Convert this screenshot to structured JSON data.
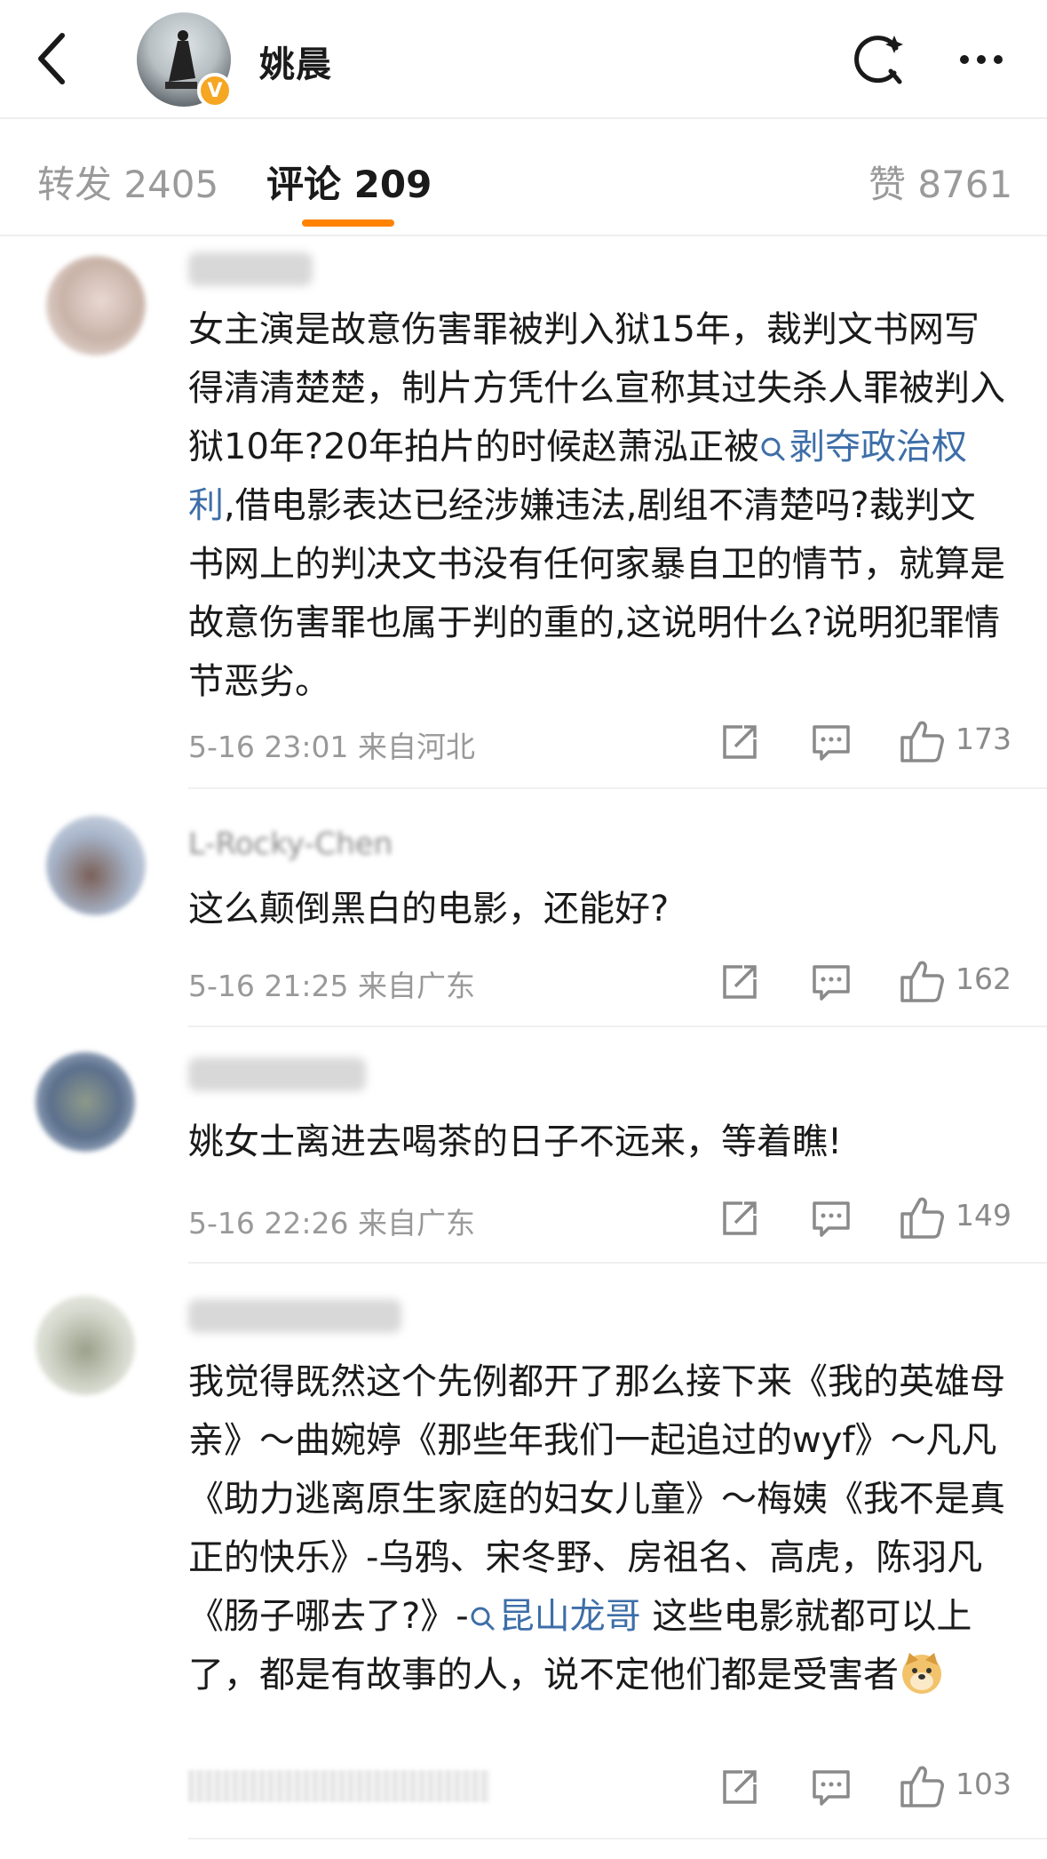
{
  "header": {
    "back_icon": "chevron-left-icon",
    "user_name": "姚晨",
    "vip_badge": "V",
    "refresh_icon": "refresh-icon",
    "more_icon": "more-dots-icon"
  },
  "tabs": {
    "repost": "转发 2405",
    "comments": "评论 209",
    "likes": "赞 8761",
    "accent": "#ff8200"
  },
  "comments": [
    {
      "username": "",
      "text_before": "女主演是故意伤害罪被判入狱15年，裁判文书网写得清清楚楚，制片方凭什么宣称其过失杀人罪被判入狱10年?20年拍片的时候赵萧泓正被",
      "topic": "剥夺政治权利",
      "text_after": ",借电影表达已经涉嫌违法,剧组不清楚吗?裁判文书网上的判决文书没有任何家暴自卫的情节，就算是故意伤害罪也属于判的重的,这说明什么?说明犯罪情节恶劣。",
      "meta": "5-16 23:01 来自河北",
      "likes": "173"
    },
    {
      "username": "L-Rocky-Chen",
      "text": "这么颠倒黑白的电影，还能好?",
      "meta": "5-16 21:25 来自广东",
      "likes": "162"
    },
    {
      "username": "",
      "text": "姚女士离进去喝茶的日子不远来，等着瞧!",
      "meta": "5-16 22:26 来自广东",
      "likes": "149"
    },
    {
      "username": "",
      "text_before": "我觉得既然这个先例都开了那么接下来《我的英雄母亲》～曲婉婷《那些年我们一起追过的wyf》～凡凡《助力逃离原生家庭的妇女儿童》～梅姨《我不是真正的快乐》-乌鸦、宋冬野、房祖名、高虎，陈羽凡《肠子哪去了?》-",
      "topic": "昆山龙哥",
      "text_after": " 这些电影就都可以上了，都是有故事的人，说不定他们都是受害者",
      "emoji": "doge-emoji",
      "meta": "",
      "likes": "103"
    }
  ],
  "icons": {
    "share": "share-icon",
    "comment": "comment-icon",
    "like": "thumbs-up-icon",
    "topic": "search-icon"
  },
  "colors": {
    "link": "#3d6ea8",
    "meta": "#999999",
    "vip": "#f5a623"
  }
}
